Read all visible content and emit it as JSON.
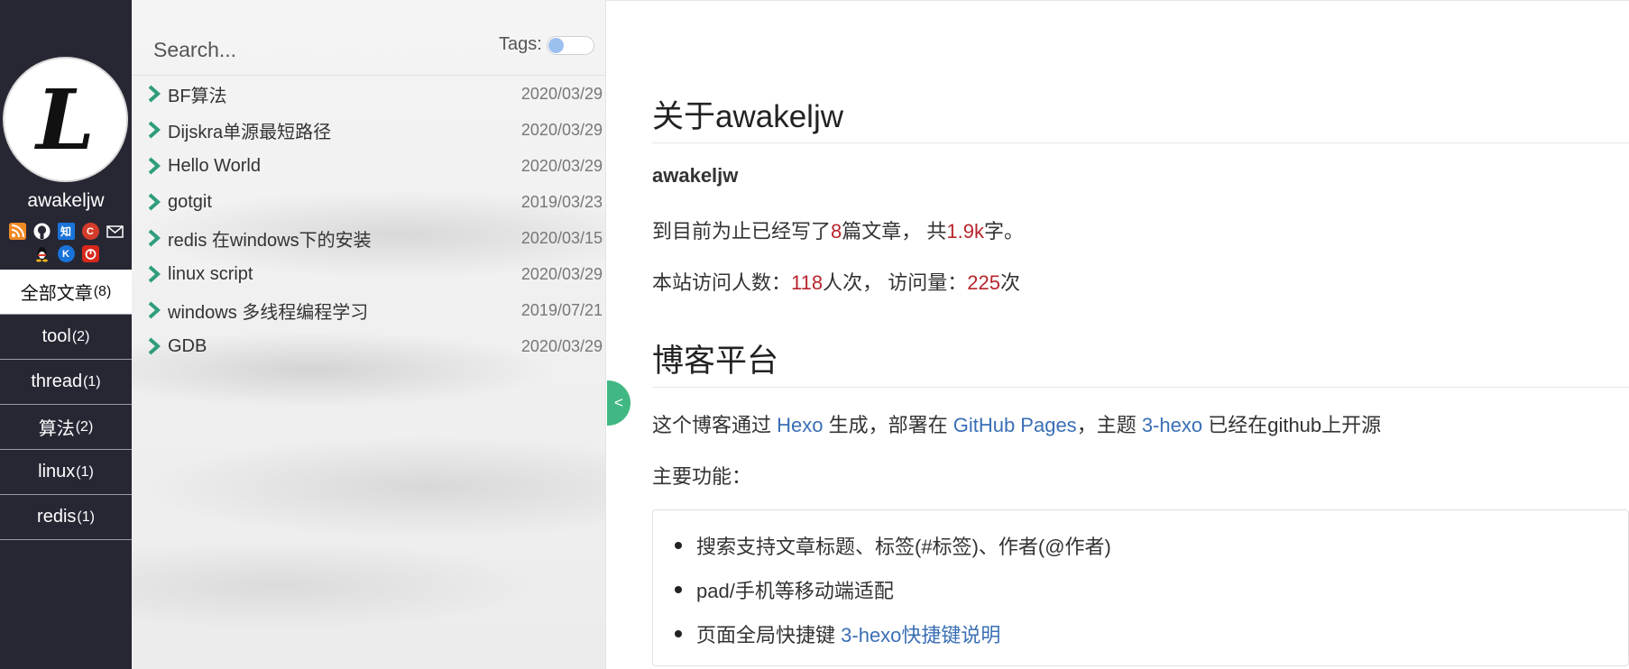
{
  "sidebar": {
    "avatar_letter": "L",
    "username": "awakeljw",
    "social": [
      {
        "icon": "rss-icon",
        "glyph": ""
      },
      {
        "icon": "github-icon",
        "glyph": ""
      },
      {
        "icon": "zhihu-icon",
        "glyph": "知"
      },
      {
        "icon": "csdn-icon",
        "glyph": "C"
      },
      {
        "icon": "mail-icon",
        "glyph": ""
      },
      {
        "icon": "qq-icon",
        "glyph": ""
      },
      {
        "icon": "cnblogs-icon",
        "glyph": "K"
      },
      {
        "icon": "netease-icon",
        "glyph": ""
      }
    ],
    "nav": [
      {
        "label": "全部文章",
        "count": "(8)",
        "active": true
      },
      {
        "label": "tool",
        "count": "(2)"
      },
      {
        "label": "thread",
        "count": "(1)"
      },
      {
        "label": "算法",
        "count": "(2)"
      },
      {
        "label": "linux",
        "count": "(1)"
      },
      {
        "label": "redis",
        "count": "(1)"
      }
    ]
  },
  "search": {
    "placeholder": "Search...",
    "tags_label": "Tags:"
  },
  "posts": [
    {
      "title": "BF算法",
      "date": "2020/03/29"
    },
    {
      "title": "Dijskra单源最短路径",
      "date": "2020/03/29"
    },
    {
      "title": "Hello World",
      "date": "2020/03/29"
    },
    {
      "title": "gotgit",
      "date": "2019/03/23"
    },
    {
      "title": "redis 在windows下的安装",
      "date": "2020/03/15"
    },
    {
      "title": "linux script",
      "date": "2020/03/29"
    },
    {
      "title": "windows 多线程编程学习",
      "date": "2019/07/21"
    },
    {
      "title": "GDB",
      "date": "2020/03/29"
    }
  ],
  "toggle_panel_label": "<",
  "main": {
    "about_heading": "关于awakeljw",
    "author": "awakeljw",
    "stats_line": {
      "prefix": "到目前为止已经写了",
      "posts": "8",
      "mid": "篇文章，  共",
      "words": "1.9k",
      "suffix": "字。"
    },
    "visits_line": {
      "prefix": "本站访问人数：",
      "visitors": "118",
      "mid": "人次，  访问量：",
      "views": "225",
      "suffix": "次"
    },
    "platform_heading": "博客平台",
    "platform_line": {
      "t1": "这个博客通过 ",
      "l1": "Hexo",
      "t2": " 生成，部署在 ",
      "l2": "GitHub Pages",
      "t3": "，主题 ",
      "l3": "3-hexo",
      "t4": " 已经在github上开源"
    },
    "features_label": "主要功能：",
    "features": [
      {
        "text": "搜索支持文章标题、标签(#标签)、作者(@作者)"
      },
      {
        "text": "pad/手机等移动端适配"
      },
      {
        "text": "页面全局快捷键 ",
        "link": "3-hexo快捷键说明"
      }
    ]
  }
}
